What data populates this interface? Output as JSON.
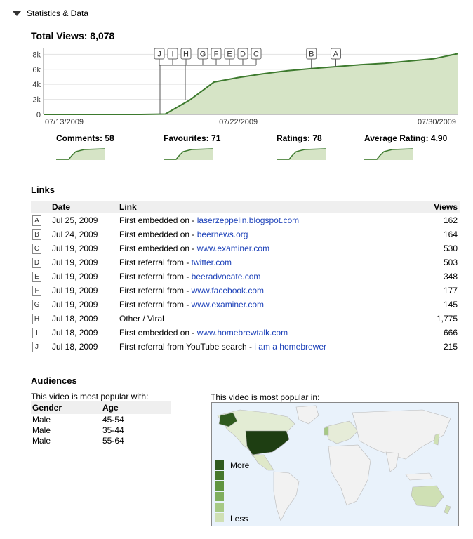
{
  "section": {
    "title": "Statistics & Data"
  },
  "total_views": "Total Views: 8,078",
  "chart_data": {
    "type": "area",
    "title": "Total Views: 8,078",
    "x_tick_labels": [
      "07/13/2009",
      "07/22/2009",
      "07/30/2009"
    ],
    "y_tick_labels": [
      "0",
      "2k",
      "4k",
      "6k",
      "8k"
    ],
    "ylim": [
      0,
      8500
    ],
    "x_dates": [
      "07/13/2009",
      "07/14/2009",
      "07/15/2009",
      "07/16/2009",
      "07/17/2009",
      "07/18/2009",
      "07/19/2009",
      "07/20/2009",
      "07/21/2009",
      "07/22/2009",
      "07/23/2009",
      "07/24/2009",
      "07/25/2009",
      "07/26/2009",
      "07/27/2009",
      "07/28/2009",
      "07/29/2009",
      "07/30/2009"
    ],
    "values": [
      0,
      0,
      0,
      0,
      0,
      50,
      1900,
      4300,
      4900,
      5400,
      5800,
      6100,
      6350,
      6600,
      6800,
      7100,
      7400,
      8078
    ],
    "grid": true,
    "color": "#3d7a2e",
    "fill": "#d6e4c6",
    "markers": [
      {
        "label": "J",
        "date": "07/18/2009"
      },
      {
        "label": "I",
        "date": "07/18/2009"
      },
      {
        "label": "H",
        "date": "07/18/2009"
      },
      {
        "label": "G",
        "date": "07/19/2009"
      },
      {
        "label": "F",
        "date": "07/19/2009"
      },
      {
        "label": "E",
        "date": "07/19/2009"
      },
      {
        "label": "D",
        "date": "07/19/2009"
      },
      {
        "label": "C",
        "date": "07/19/2009"
      },
      {
        "label": "B",
        "date": "07/24/2009"
      },
      {
        "label": "A",
        "date": "07/25/2009"
      }
    ]
  },
  "stats": [
    {
      "label": "Comments: 58"
    },
    {
      "label": "Favourites: 71"
    },
    {
      "label": "Ratings: 78"
    },
    {
      "label": "Average Rating: 4.90"
    }
  ],
  "links": {
    "title": "Links",
    "headers": {
      "date": "Date",
      "link": "Link",
      "views": "Views"
    },
    "rows": [
      {
        "marker": "A",
        "date": "Jul 25, 2009",
        "prefix": "First embedded on - ",
        "anchor": "laserzeppelin.blogspot.com",
        "views": "162"
      },
      {
        "marker": "B",
        "date": "Jul 24, 2009",
        "prefix": "First embedded on - ",
        "anchor": "beernews.org",
        "views": "164"
      },
      {
        "marker": "C",
        "date": "Jul 19, 2009",
        "prefix": "First embedded on - ",
        "anchor": "www.examiner.com",
        "views": "530"
      },
      {
        "marker": "D",
        "date": "Jul 19, 2009",
        "prefix": "First referral from - ",
        "anchor": "twitter.com",
        "views": "503"
      },
      {
        "marker": "E",
        "date": "Jul 19, 2009",
        "prefix": "First referral from - ",
        "anchor": "beeradvocate.com",
        "views": "348"
      },
      {
        "marker": "F",
        "date": "Jul 19, 2009",
        "prefix": "First referral from - ",
        "anchor": "www.facebook.com",
        "views": "177"
      },
      {
        "marker": "G",
        "date": "Jul 19, 2009",
        "prefix": "First referral from - ",
        "anchor": "www.examiner.com",
        "views": "145"
      },
      {
        "marker": "H",
        "date": "Jul 18, 2009",
        "prefix": "Other / Viral",
        "anchor": "",
        "views": "1,775"
      },
      {
        "marker": "I",
        "date": "Jul 18, 2009",
        "prefix": "First embedded on - ",
        "anchor": "www.homebrewtalk.com",
        "views": "666"
      },
      {
        "marker": "J",
        "date": "Jul 18, 2009",
        "prefix": "First referral from YouTube search - ",
        "anchor": "i am a homebrewer",
        "views": "215"
      }
    ]
  },
  "audiences": {
    "title": "Audiences",
    "subtitle": "This video is most popular with:",
    "headers": {
      "gender": "Gender",
      "age": "Age"
    },
    "rows": [
      {
        "gender": "Male",
        "age": "45-54"
      },
      {
        "gender": "Male",
        "age": "35-44"
      },
      {
        "gender": "Male",
        "age": "55-64"
      }
    ]
  },
  "map": {
    "caption": "This video is most popular in:",
    "legend_more": "More",
    "legend_less": "Less",
    "legend_colors": [
      "#2f5a1e",
      "#46782c",
      "#5f943f",
      "#7fae5d",
      "#a6c985",
      "#cfe0b4"
    ],
    "land_color": "#f2f2f2",
    "water_color": "#e9f2fb"
  }
}
